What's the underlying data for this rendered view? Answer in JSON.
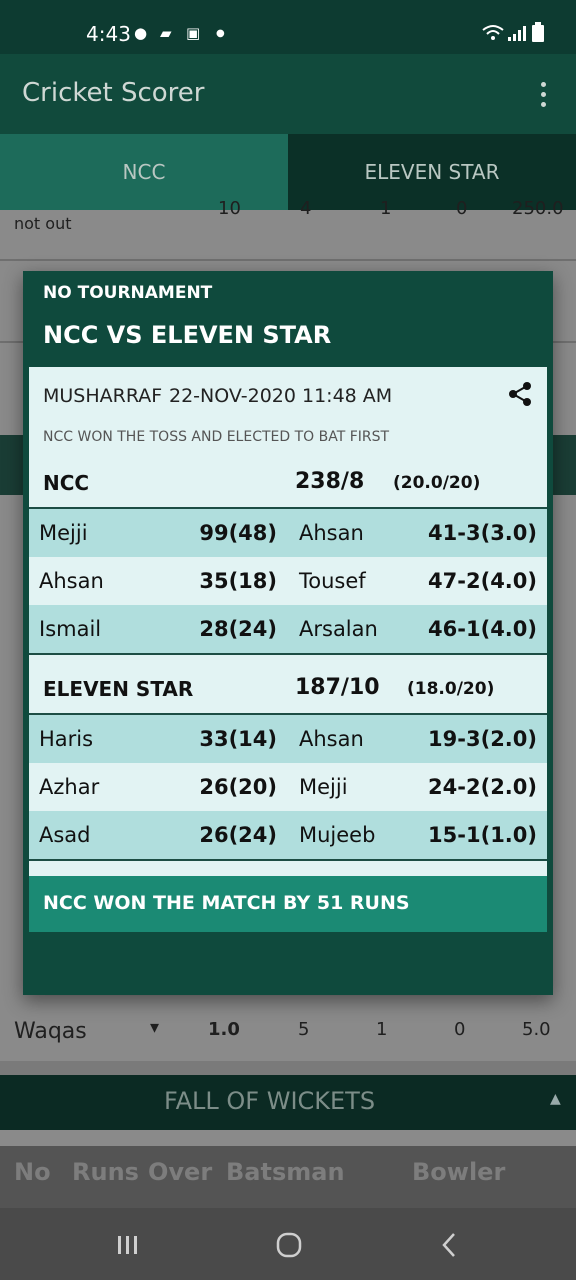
{
  "status_bar": {
    "time": "4:43"
  },
  "app_bar": {
    "title": "Cricket Scorer"
  },
  "tabs": [
    {
      "label": "NCC",
      "active": true
    },
    {
      "label": "ELEVEN STAR",
      "active": false
    }
  ],
  "background": {
    "partial_row": {
      "status": "not out",
      "values": [
        "10",
        "4",
        "1",
        "0",
        "250.0"
      ]
    },
    "waqas_row": {
      "name": "Waqas",
      "values": [
        "1.0",
        "5",
        "1",
        "0",
        "5.0"
      ]
    },
    "fall_of_wickets": {
      "title": "FALL OF WICKETS",
      "columns": [
        "No",
        "Runs",
        "Over",
        "Batsman",
        "Bowler"
      ]
    }
  },
  "dialog": {
    "tournament": "NO TOURNAMENT",
    "matchup": "NCC VS ELEVEN STAR",
    "scorer": "MUSHARRAF",
    "datetime": "22-NOV-2020 11:48 AM",
    "toss": "NCC WON THE TOSS AND ELECTED TO BAT FIRST",
    "innings": [
      {
        "team": "NCC",
        "score": "238/8",
        "overs": "(20.0/20)",
        "rows": [
          {
            "batsman": "Mejji",
            "bat": "99(48)",
            "bowler": "Ahsan",
            "bowl": "41-3(3.0)"
          },
          {
            "batsman": "Ahsan",
            "bat": "35(18)",
            "bowler": "Tousef",
            "bowl": "47-2(4.0)"
          },
          {
            "batsman": "Ismail",
            "bat": "28(24)",
            "bowler": "Arsalan",
            "bowl": "46-1(4.0)"
          }
        ]
      },
      {
        "team": "ELEVEN STAR",
        "score": "187/10",
        "overs": "(18.0/20)",
        "rows": [
          {
            "batsman": "Haris",
            "bat": "33(14)",
            "bowler": "Ahsan",
            "bowl": "19-3(2.0)"
          },
          {
            "batsman": "Azhar",
            "bat": "26(20)",
            "bowler": "Mejji",
            "bowl": "24-2(2.0)"
          },
          {
            "batsman": "Asad",
            "bat": "26(24)",
            "bowler": "Mujeeb",
            "bowl": "15-1(1.0)"
          }
        ]
      }
    ],
    "result": "NCC WON THE MATCH BY 51 RUNS"
  }
}
